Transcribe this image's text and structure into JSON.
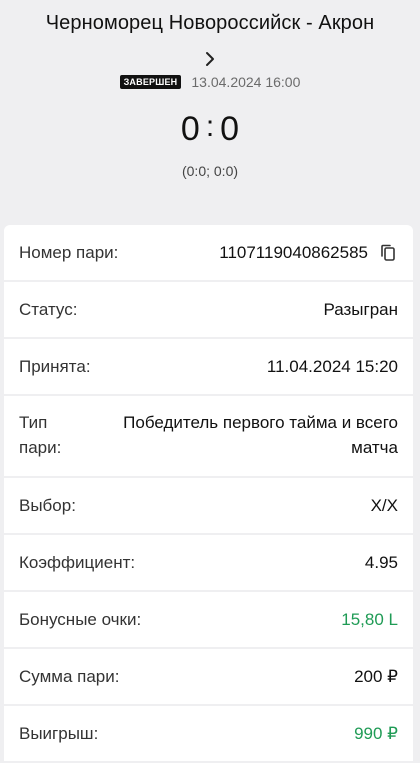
{
  "match": {
    "title": "Черноморец Новороссийск - Акрон",
    "status_badge": "ЗАВЕРШЕН",
    "datetime": "13.04.2024 16:00",
    "score_home": "0",
    "score_sep": ":",
    "score_away": "0",
    "partial": "(0:0; 0:0)"
  },
  "bet": {
    "id_label": "Номер пари:",
    "id_value": "1107119040862585",
    "status_label": "Статус:",
    "status_value": "Разыгран",
    "accepted_label": "Принята:",
    "accepted_value": "11.04.2024 15:20",
    "type_label": "Тип пари:",
    "type_value": "Победитель первого тайма и всего матча",
    "choice_label": "Выбор:",
    "choice_value": "Х/Х",
    "odds_label": "Коэффициент:",
    "odds_value": "4.95",
    "bonus_label": "Бонусные очки:",
    "bonus_value": "15,80 L",
    "stake_label": "Сумма пари:",
    "stake_value": "200 ₽",
    "win_label": "Выигрыш:",
    "win_value": "990 ₽"
  },
  "colors": {
    "accent_green": "#1f9b55",
    "background": "#efeff1"
  },
  "icons": [
    "chevron-right-icon",
    "copy-icon"
  ]
}
